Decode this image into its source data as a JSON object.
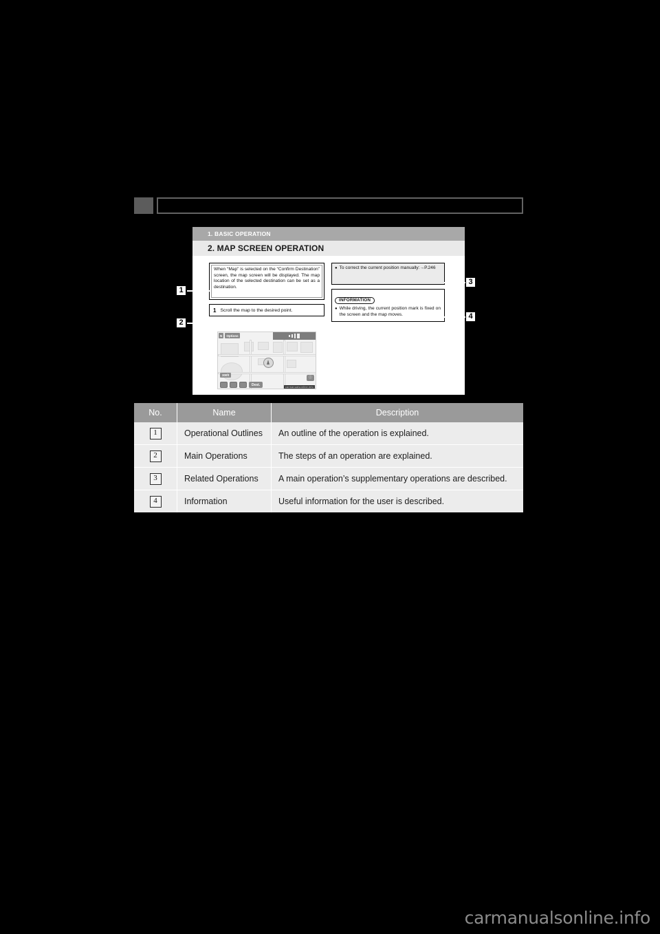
{
  "page": {
    "background_color": "#000000",
    "watermark": "carmanualsonline.info"
  },
  "header": {
    "tab_marker": "",
    "title": ""
  },
  "figure": {
    "section_band": "1. BASIC OPERATION",
    "section_title": "2. MAP SCREEN OPERATION",
    "operational_outline": "When “Map” is selected on the “Confirm Destination” screen, the map screen will be displayed. The map location of the selected destination can be set as a destination.",
    "main_operation_step_number": "1",
    "main_operation_step_text": "Scroll the map to the desired point.",
    "related_operation_bullet": "●",
    "related_operation_text": "To correct the current position manually:→P.246",
    "information_label": "INFORMATION",
    "information_bullet": "●",
    "information_text": "While driving, the current position mark is fixed on the screen and the map moves.",
    "nav_screenshot": {
      "top_left_chips": [
        "N",
        "Options"
      ],
      "scale_label": "300ft",
      "dest_button": "Dest.",
      "help_button": "ⓘ",
      "watermark": "carmanualsonline.info"
    }
  },
  "callouts": [
    {
      "number": "1",
      "target": "operational-outlines-box"
    },
    {
      "number": "2",
      "target": "main-operations-box"
    },
    {
      "number": "3",
      "target": "related-operations-box"
    },
    {
      "number": "4",
      "target": "information-box"
    }
  ],
  "legend_table": {
    "headers": [
      "No.",
      "Name",
      "Description"
    ],
    "rows": [
      {
        "no": "1",
        "name": "Operational Outlines",
        "description": "An outline of the operation is explained."
      },
      {
        "no": "2",
        "name": "Main Operations",
        "description": "The steps of an operation are explained."
      },
      {
        "no": "3",
        "name": "Related Operations",
        "description": "A main operation’s supplementary operations are described."
      },
      {
        "no": "4",
        "name": "Information",
        "description": "Useful information for the user is described."
      }
    ]
  },
  "colors": {
    "page_bg": "#000000",
    "band_gray": "#a8a8a8",
    "subband_gray": "#e9e9e9",
    "table_header_gray": "#9a9a9a",
    "table_cell_gray": "#ececec",
    "header_tab_gray": "#5c5c5c",
    "watermark_gray": "#8c8c8c"
  }
}
